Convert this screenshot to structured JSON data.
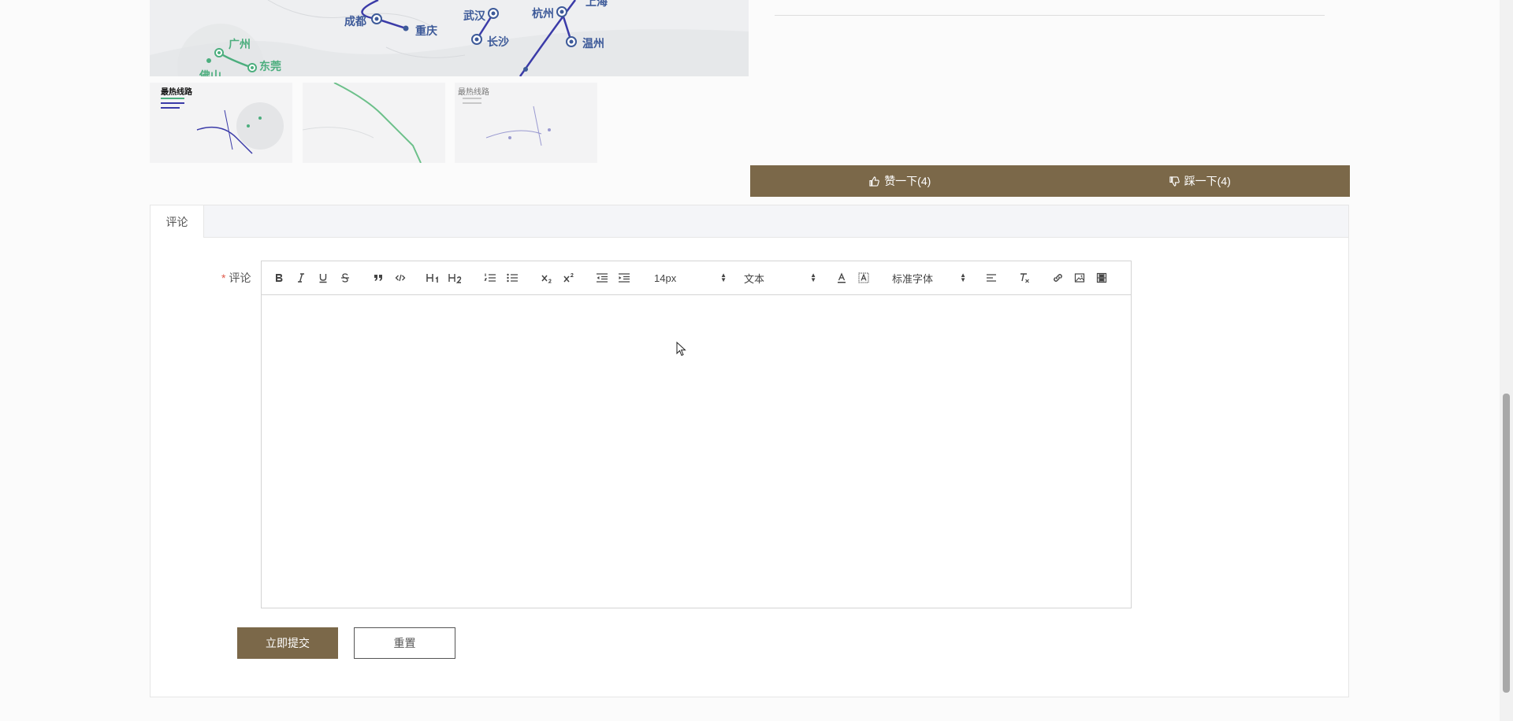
{
  "map": {
    "cities": [
      {
        "name": "成都",
        "tone": "blue"
      },
      {
        "name": "重庆",
        "tone": "blue"
      },
      {
        "name": "武汉",
        "tone": "blue"
      },
      {
        "name": "杭州",
        "tone": "blue"
      },
      {
        "name": "上海",
        "tone": "blue"
      },
      {
        "name": "长沙",
        "tone": "blue"
      },
      {
        "name": "温州",
        "tone": "blue"
      },
      {
        "name": "广州",
        "tone": "green"
      },
      {
        "name": "东莞",
        "tone": "green"
      },
      {
        "name": "佛山",
        "tone": "green"
      }
    ],
    "thumbnails": [
      {
        "title": "最热线路"
      },
      {
        "title": ""
      },
      {
        "title": "最热线路"
      }
    ]
  },
  "vote": {
    "like_label": "赞一下(4)",
    "dislike_label": "踩一下(4)",
    "like_icon": "thumbs-up-icon",
    "dislike_icon": "thumbs-down-icon"
  },
  "comment": {
    "tab_label": "评论",
    "required_mark": "*",
    "field_label": "评论",
    "toolbar": {
      "font_size": "14px",
      "header_type": "文本",
      "font_family": "标准字体",
      "h1": "H1",
      "h2": "H2"
    },
    "submit_label": "立即提交",
    "reset_label": "重置"
  },
  "colors": {
    "brand": "#7b6849",
    "required": "#e05a4b",
    "route_blue": "#3b3ba8",
    "route_green": "#4cae7e"
  }
}
